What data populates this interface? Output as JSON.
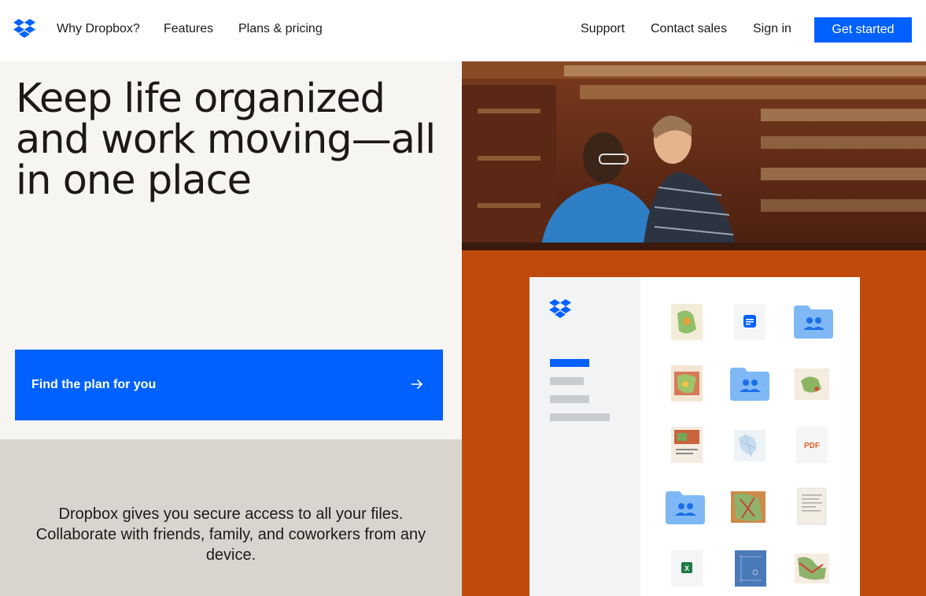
{
  "nav": {
    "logo": "dropbox-logo",
    "links": [
      "Why Dropbox?",
      "Features",
      "Plans & pricing"
    ],
    "right_links": [
      "Support",
      "Contact sales",
      "Sign in"
    ],
    "cta": "Get started"
  },
  "hero": {
    "headline": "Keep life organized and work moving—all in one place",
    "plan_button": "Find the plan for you",
    "description": "Dropbox gives you secure access to all your files. Collaborate with friends, family, and coworkers from any device."
  },
  "illustration": {
    "file_tiles": [
      [
        "map",
        "doc-icon",
        "shared-folder"
      ],
      [
        "map",
        "shared-folder",
        "map"
      ],
      [
        "map",
        "map",
        "PDF"
      ],
      [
        "shared-folder",
        "map",
        "document"
      ],
      [
        "xlsx-icon",
        "blueprint",
        "map"
      ]
    ]
  },
  "colors": {
    "brand_blue": "#0061fe",
    "orange": "#bf4a0c",
    "hero_bg": "#f7f5f2",
    "bottom_bg": "#d9d5ce"
  }
}
